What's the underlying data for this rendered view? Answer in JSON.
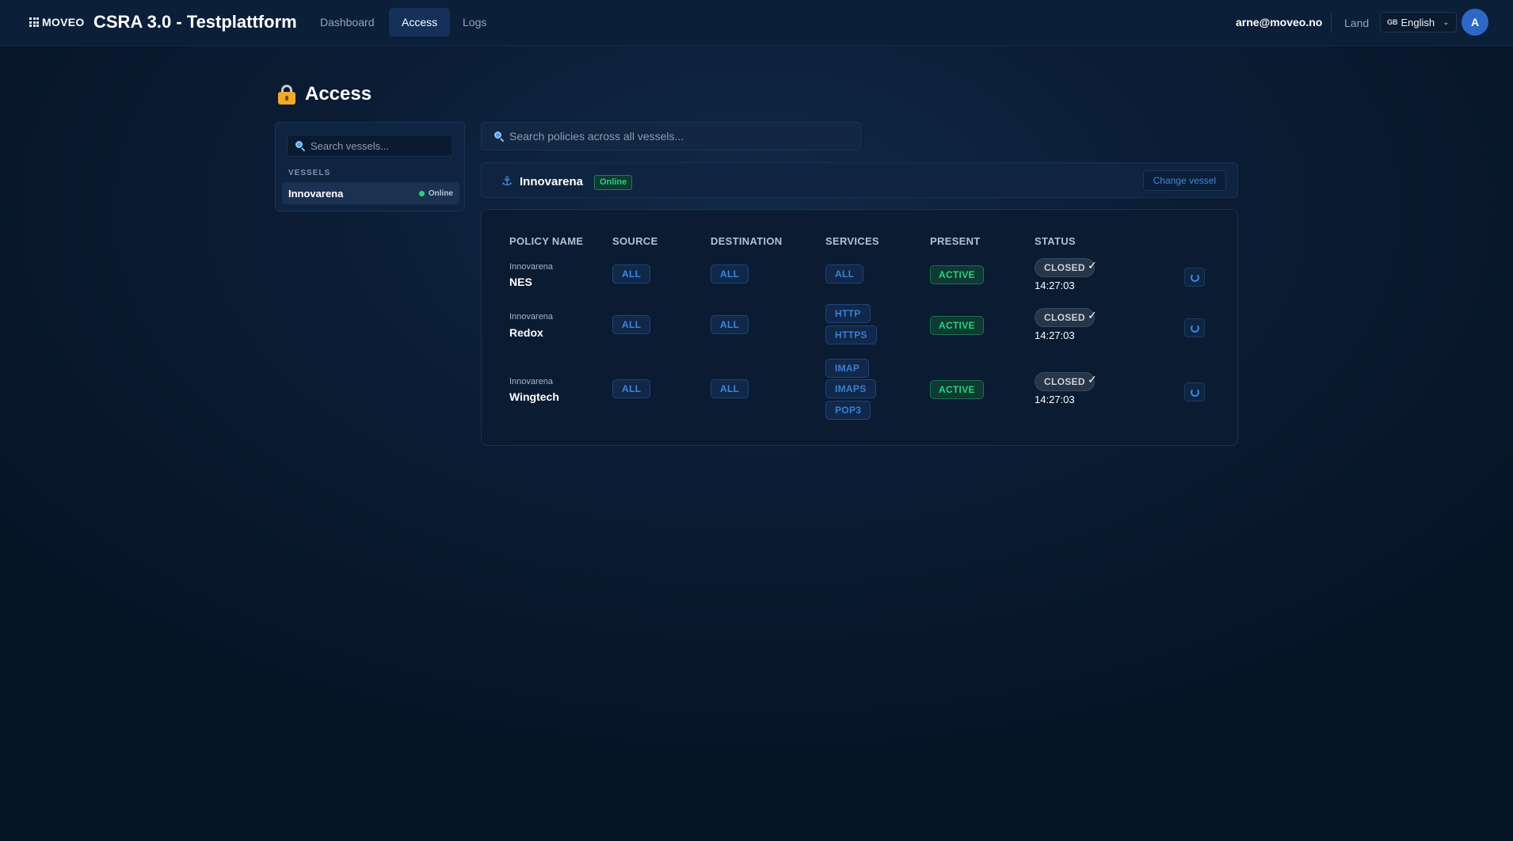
{
  "header": {
    "logo": "MOVEO",
    "app_title": "CSRA 3.0 - Testplattform",
    "nav": [
      "Dashboard",
      "Access",
      "Logs"
    ],
    "active_nav": "Access",
    "user_email": "arne@moveo.no",
    "land_label": "Land",
    "language": {
      "flag": "GB",
      "label": "English"
    },
    "avatar_initial": "A"
  },
  "page": {
    "title": "Access"
  },
  "sidebar": {
    "search_placeholder": "Search vessels...",
    "section_label": "VESSELS",
    "vessels": [
      {
        "name": "Innovarena",
        "status": "Online"
      }
    ]
  },
  "policy_search": {
    "placeholder": "Search policies across all vessels..."
  },
  "selected_vessel": {
    "name": "Innovarena",
    "status": "Online",
    "change_label": "Change vessel"
  },
  "table": {
    "columns": [
      "POLICY NAME",
      "SOURCE",
      "DESTINATION",
      "SERVICES",
      "PRESENT",
      "STATUS"
    ],
    "rows": [
      {
        "vessel": "Innovarena",
        "name": "NES",
        "source": "ALL",
        "destination": "ALL",
        "services": [
          "ALL"
        ],
        "present": "ACTIVE",
        "status": "CLOSED",
        "check": "✓",
        "time": "14:27:03"
      },
      {
        "vessel": "Innovarena",
        "name": "Redox",
        "source": "ALL",
        "destination": "ALL",
        "services": [
          "HTTP",
          "HTTPS"
        ],
        "present": "ACTIVE",
        "status": "CLOSED",
        "check": "✓",
        "time": "14:27:03"
      },
      {
        "vessel": "Innovarena",
        "name": "Wingtech",
        "source": "ALL",
        "destination": "ALL",
        "services": [
          "IMAP",
          "IMAPS",
          "POP3"
        ],
        "present": "ACTIVE",
        "status": "CLOSED",
        "check": "✓",
        "time": "14:27:03"
      }
    ]
  },
  "colors": {
    "background": "#0b1d35",
    "accent": "#3a86e0",
    "active_green": "#2ed17c",
    "online_green": "#2bd27b",
    "closed_gray": "#283548"
  }
}
